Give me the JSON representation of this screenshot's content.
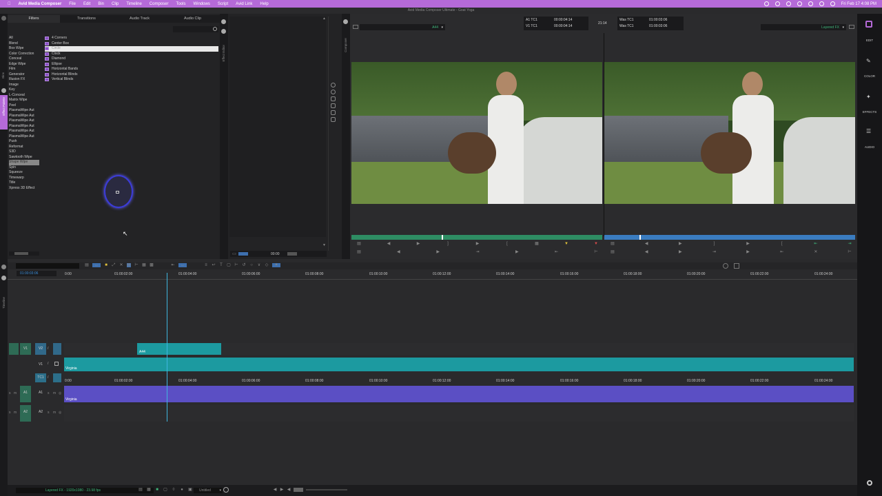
{
  "menubar": {
    "app": "Avid Media Composer",
    "items": [
      "File",
      "Edit",
      "Bin",
      "Clip",
      "Timeline",
      "Composer",
      "Tools",
      "Windows",
      "Script",
      "Avid Link",
      "Help"
    ],
    "clock": "Fri Feb 17  4:08 PM"
  },
  "window_title": "Avid Media Composer Ultimate - Goat Yoga",
  "effect_palette": {
    "tabs": [
      "Filters",
      "Transitions",
      "Audio Track",
      "Audio Clip"
    ],
    "side_labels": [
      "Bins",
      "Effect Palette"
    ],
    "categories": [
      "All",
      "Blend",
      "Box Wipe",
      "Color Correction",
      "Conceal",
      "Edge Wipe",
      "Film",
      "Generator",
      "Illusion FX",
      "Image",
      "Key",
      "L-Conceal",
      "Matrix Wipe",
      "Peel",
      "PlasmaWipe Aut",
      "PlasmaWipe Aut",
      "PlasmaWipe Aut",
      "PlasmaWipe Aut",
      "PlasmaWipe Aut",
      "PlasmaWipe Aut",
      "Push",
      "Reformat",
      "S3D",
      "Sawtooth Wipe",
      "Shape Wipe",
      "Spin",
      "Squeeze",
      "Timewarp",
      "Title",
      "Xpress 3D Effect"
    ],
    "selected_category_index": 24,
    "effects": [
      "4 Corners",
      "Center Box",
      "Circle",
      "Clock",
      "Diamond",
      "Ellipse",
      "Horizontal Bands",
      "Horizontal Blinds",
      "Vertical Blinds"
    ],
    "selected_effect_index": 2
  },
  "effect_editor": {
    "side_label": "Effect Editor",
    "timecode": "00:00"
  },
  "composer": {
    "side_label": "Composer",
    "left_track": "A44",
    "right_track": "Layered FX",
    "tc_lines": [
      {
        "label": "A1 TC1",
        "value": "00:00:04:14"
      },
      {
        "label": "V1 TC1",
        "value": "00:00:04:14"
      }
    ],
    "center_tc": "21:14",
    "was_lines": [
      {
        "label": "Was TC1",
        "value": "01:00:03:06"
      },
      {
        "label": "Was TC1",
        "value": "01:00:03:06"
      }
    ],
    "left_playhead": 0.36,
    "right_playhead": 0.14
  },
  "right_sidebar": {
    "items": [
      "EDIT",
      "COLOR",
      "EFFECTS",
      "AUDIO"
    ]
  },
  "timeline": {
    "side_label": "Timeline",
    "master_tc": "01:00:03:06",
    "ruler": [
      "0:00",
      "01:00:02:00",
      "01:00:04:00",
      "01:00:06:00",
      "01:00:08:00",
      "01:00:10:00",
      "01:00:12:00",
      "01:00:14:00",
      "01:00:16:00",
      "01:00:18:00",
      "01:00:20:00",
      "01:00:22:00",
      "01:00:24:00"
    ],
    "tracks": {
      "v2_clip": "A44",
      "v1_clip": "Virginia",
      "a1_clip": "Virginia"
    },
    "labels": {
      "v1": "V1",
      "v2": "V2",
      "v1b": "V1",
      "tc1": "TC1",
      "a1": "A1",
      "a1b": "A1",
      "a2": "A2",
      "a2b": "A2"
    }
  },
  "status": {
    "format": "Layered FX - 1920x1080 - 23.98 fps",
    "sequence": "Untitled"
  }
}
